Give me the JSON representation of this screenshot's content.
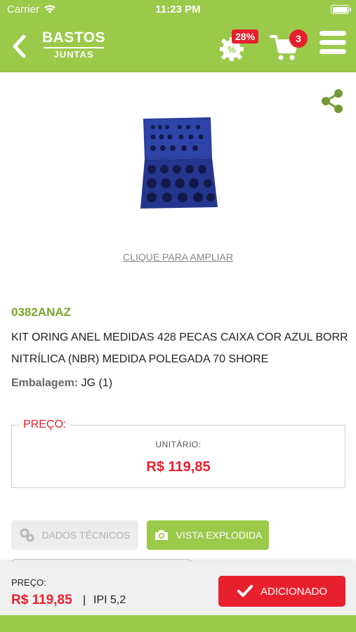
{
  "status_bar": {
    "carrier": "Carrier",
    "time": "11:23 PM"
  },
  "nav": {
    "logo_line1": "BASTOS",
    "logo_line2": "JUNTAS",
    "promo_badge": "28%",
    "cart_count": "3"
  },
  "product": {
    "enlarge_label": "CLIQUE PARA AMPLIAR",
    "code": "0382ANAZ",
    "title": "KIT ORING ANEL MEDIDAS 428 PECAS CAIXA COR AZUL BORR NITRÍLICA (NBR) MEDIDA POLEGADA 70 SHORE",
    "packaging_label": "Embalagem:",
    "packaging_value": "JG (1)"
  },
  "price_box": {
    "legend": "PREÇO:",
    "unit_label": "UNITÁRIO:",
    "value": "R$ 119,85"
  },
  "buttons": {
    "technical_data": "DADOS TÉCNICOS",
    "exploded_view": "VISTA EXPLODIDA",
    "add": "ADICIONADO"
  },
  "footer": {
    "price_label": "PREÇO:",
    "price_value": "R$ 119,85",
    "separator": "|",
    "ipi": "IPI 5,2"
  },
  "colors": {
    "brand_green": "#9bc94a",
    "accent_red": "#e8202e",
    "code_green": "#76a52e"
  },
  "icons": [
    "back-chevron-icon",
    "percent-gear-icon",
    "cart-icon",
    "menu-icon",
    "share-icon",
    "gears-icon",
    "camera-icon",
    "checkmark-icon",
    "wifi-icon",
    "battery-icon"
  ]
}
